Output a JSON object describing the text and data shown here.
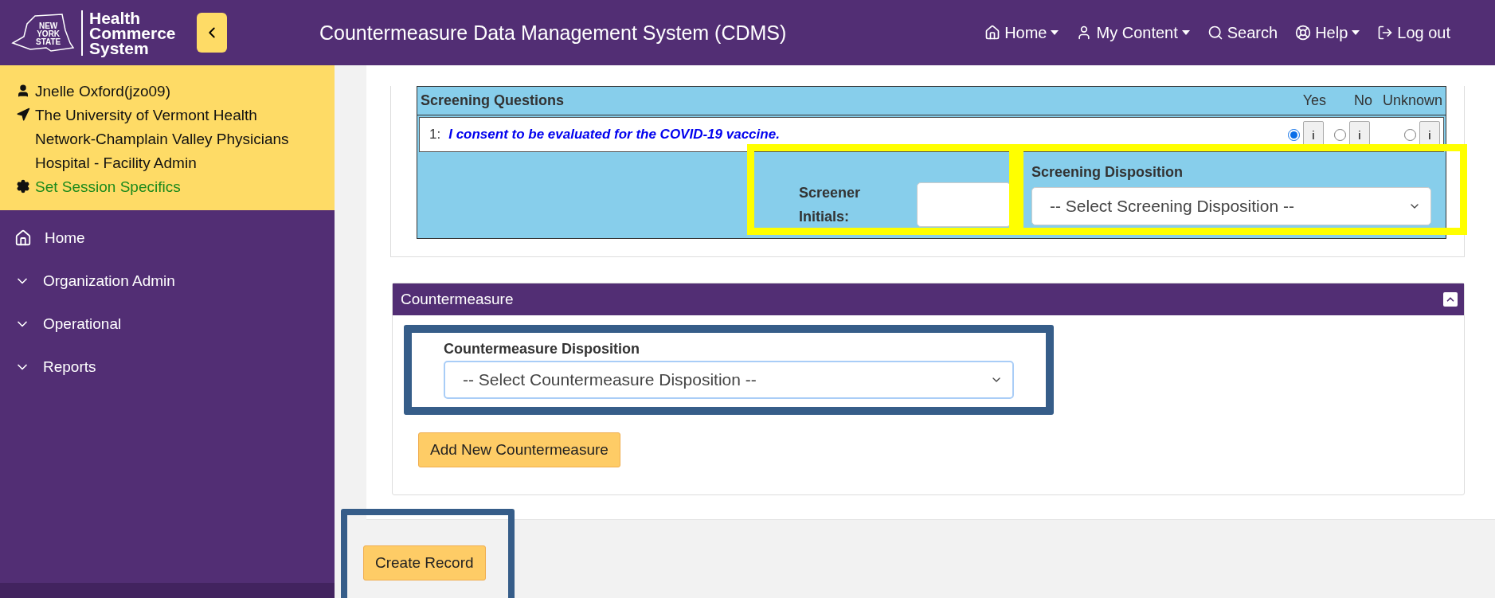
{
  "header": {
    "logo_lines": [
      "NEW",
      "YORK",
      "STATE"
    ],
    "brand_lines": [
      "Health",
      "Commerce",
      "System"
    ],
    "title": "Countermeasure Data Management System (CDMS)",
    "nav": [
      {
        "kind": "home",
        "label": "Home",
        "dropdown": true
      },
      {
        "kind": "user",
        "label": "My Content",
        "dropdown": true
      },
      {
        "kind": "search",
        "label": "Search",
        "dropdown": false
      },
      {
        "kind": "help",
        "label": "Help",
        "dropdown": true
      },
      {
        "kind": "logout",
        "label": "Log out",
        "dropdown": false
      }
    ]
  },
  "session": {
    "user": "Jnelle Oxford(jzo09)",
    "location": "The University of Vermont Health Network-Champlain Valley Physicians Hospital - Facility Admin",
    "link": "Set Session Specifics"
  },
  "sidebar": {
    "items": [
      {
        "kind": "home",
        "label": "Home",
        "expanded": false
      },
      {
        "kind": "group",
        "label": "Organization Admin",
        "expanded": false
      },
      {
        "kind": "group",
        "label": "Operational",
        "expanded": false
      },
      {
        "kind": "group",
        "label": "Reports",
        "expanded": false
      }
    ]
  },
  "screening": {
    "title": "Screening Questions",
    "columns": [
      "Yes",
      "No",
      "Unknown"
    ],
    "questions": [
      {
        "number": "1:",
        "text": "I consent to be evaluated for the COVID-19 vaccine.",
        "options": [
          {
            "selected": true,
            "info": "i"
          },
          {
            "selected": false,
            "info": "i"
          },
          {
            "selected": false,
            "info": "i"
          }
        ]
      }
    ],
    "initials_label": "Screener Initials:",
    "disposition_label": "Screening Disposition",
    "disposition_placeholder": "-- Select Screening Disposition --"
  },
  "countermeasure": {
    "title": "Countermeasure",
    "disposition_label": "Countermeasure Disposition",
    "disposition_placeholder": "-- Select Countermeasure Disposition --",
    "add_button": "Add New Countermeasure"
  },
  "create_button": "Create Record"
}
